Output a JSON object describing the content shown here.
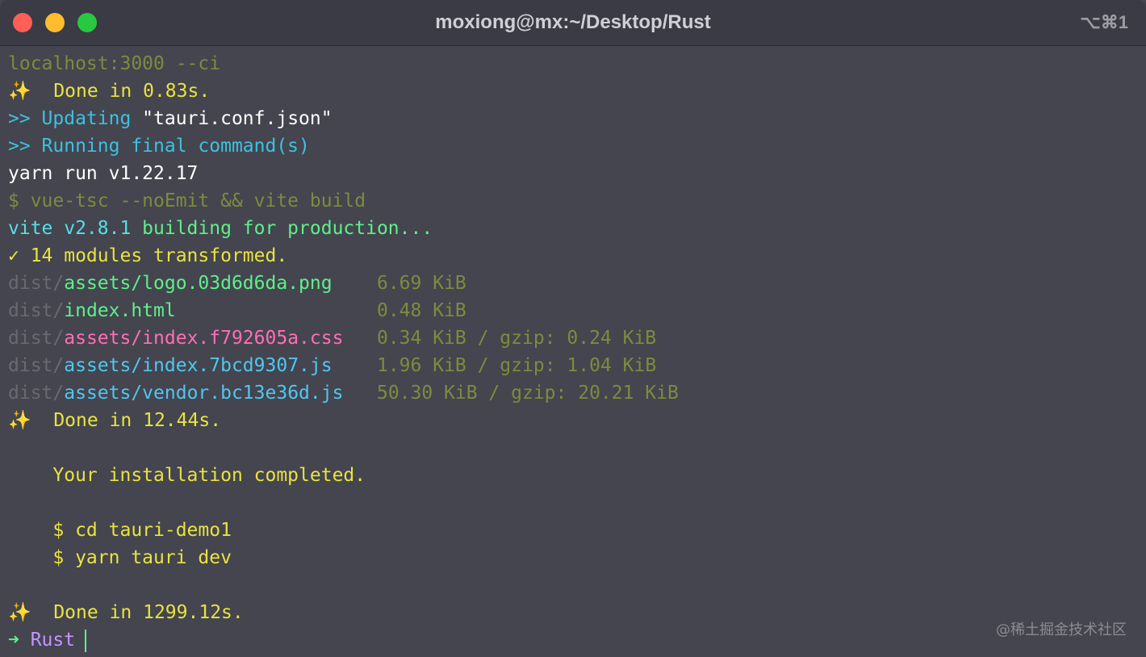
{
  "window": {
    "title": "moxiong@mx:~/Desktop/Rust",
    "shortcut": "⌥⌘1"
  },
  "terminal": {
    "lines": [
      [
        "localhost:3000 --ci"
      ],
      [
        "✨  Done in 0.83s."
      ],
      [
        ">> ",
        "Updating",
        " \"tauri.conf.json\""
      ],
      [
        ">> ",
        "Running final command(s)"
      ],
      [
        "yarn run v1.22.17"
      ],
      [
        "$ vue-tsc --noEmit && vite build"
      ],
      [
        "vite v2.8.1 ",
        "building for production..."
      ],
      [
        "✓ 14 modules transformed."
      ],
      [
        "dist/",
        "assets/logo.03d6d6da.png",
        "    6.69 KiB"
      ],
      [
        "dist/",
        "index.html",
        "                  0.48 KiB"
      ],
      [
        "dist/",
        "assets/index.f792605a.css",
        "   0.34 KiB / gzip: 0.24 KiB"
      ],
      [
        "dist/",
        "assets/index.7bcd9307.js",
        "    1.96 KiB / gzip: 1.04 KiB"
      ],
      [
        "dist/",
        "assets/vendor.bc13e36d.js",
        "   50.30 KiB / gzip: 20.21 KiB"
      ],
      [
        "✨  Done in 12.44s."
      ],
      [
        ""
      ],
      [
        "    Your installation completed."
      ],
      [
        ""
      ],
      [
        "    $ cd tauri-demo1"
      ],
      [
        "    $ yarn tauri dev"
      ],
      [
        ""
      ],
      [
        "✨  Done in 1299.12s."
      ]
    ],
    "prompt": {
      "arrow": "➜ ",
      "directory": "Rust"
    }
  },
  "watermark": "@稀土掘金技术社区",
  "colors": {
    "background": "#44454f",
    "titlebar": "#3a3b44",
    "olive": "#7f8a3c",
    "yellow": "#e8e33f",
    "cyan": "#3dc1df",
    "teal": "#56dfe8",
    "green": "#5ff089",
    "gray": "#686a70",
    "pink": "#ff6eb6",
    "blue": "#4fc7f2",
    "purple": "#c693ff"
  }
}
